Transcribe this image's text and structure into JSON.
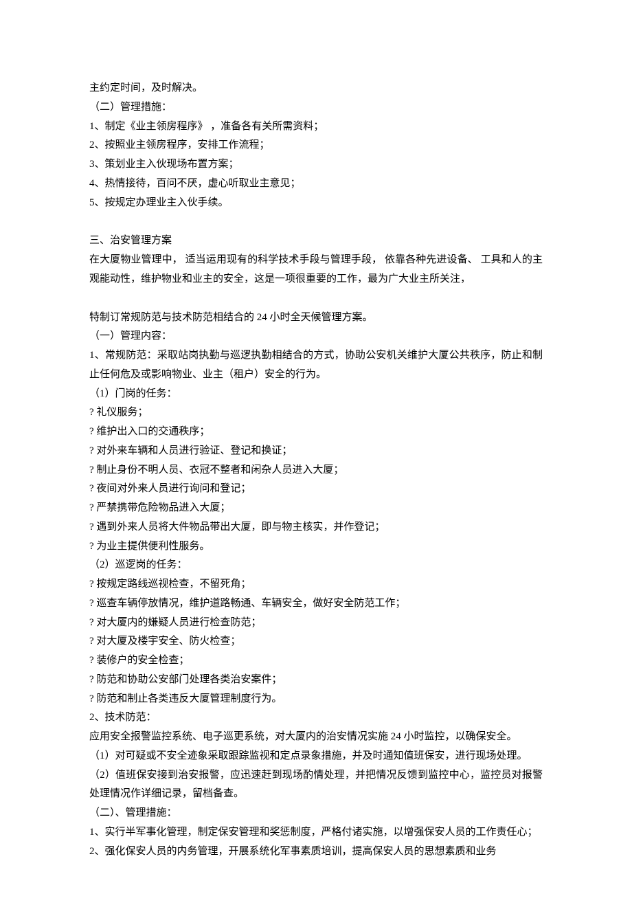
{
  "lines": [
    "主约定时间，及时解决。",
    "（二）管理措施：",
    "1、制定《业主领房程序》   ，准备各有关所需资料；",
    "2、按照业主领房程序，安排工作流程；",
    "3、策划业主入伙现场布置方案；",
    "4、热情接待，百问不厌，虚心听取业主意见；",
    "5、按规定办理业主入伙手续。",
    "",
    "三、治安管理方案",
    "在大厦物业管理中，    适当运用现有的科学技术手段与管理手段，        依靠各种先进设备、   工具和人的主观能动性，维护物业和业主的安全，这是一项很重要的工作，最为广大业主所关注，",
    "",
    "特制订常规防范与技术防范相结合的         24 小时全天候管理方案。",
    "（一）管理内容：",
    "1、常规防范：采取站岗执勤与巡逻执勤相结合的方式，协助公安机关维护大厦公共秩序，防止和制止任何危及或影响物业、业主（租户）安全的行为。",
    "（1）门岗的任务：",
    "?  礼仪服务；",
    "?  维护出入口的交通秩序；",
    "?  对外来车辆和人员进行验证、登记和换证；",
    "?  制止身份不明人员、衣冠不整者和闲杂人员进入大厦；",
    "?  夜间对外来人员进行询问和登记；",
    "?  严禁携带危险物品进入大厦；",
    "    ?  遇到外来人员将大件物品带出大厦，即与物主核实，并作登记；",
    "?  为业主提供便利性服务。",
    "（2）巡逻岗的任务：",
    "?  按规定路线巡视检查，不留死角；",
    "?  巡查车辆停放情况，维护道路畅通、车辆安全，做好安全防范工作；",
    "?  对大厦内的嫌疑人员进行检查防范；",
    "?  对大厦及楼宇安全、防火检查；",
    "?  装修户的安全检查；",
    "?  防范和协助公安部门处理各类治安案件；",
    "?  防范和制止各类违反大厦管理制度行为。",
    "2、技术防范：",
    "应用安全报警监控系统、电子巡更系统，对大厦内的治安情况实施              24 小时监控，以确保安全。",
    "（1）对可疑或不安全迹象采取跟踪监视和定点录象措施，并及时通知值班保安，进行现场处理。",
    "（2）值班保安接到治安报警，应迅速赶到现场酌情处理，并把情况反馈到监控中心，监控员对报警处理情况作详细记录，留档备查。",
    "（二）、管理措施：",
    "1、实行半军事化管理，制定保安管理和奖惩制度，严格付诸实施，以增强保安人员的工作责任心；",
    "2、强化保安人员的内务管理，开展系统化军事素质培训，提高保安人员的思想素质和业务"
  ]
}
